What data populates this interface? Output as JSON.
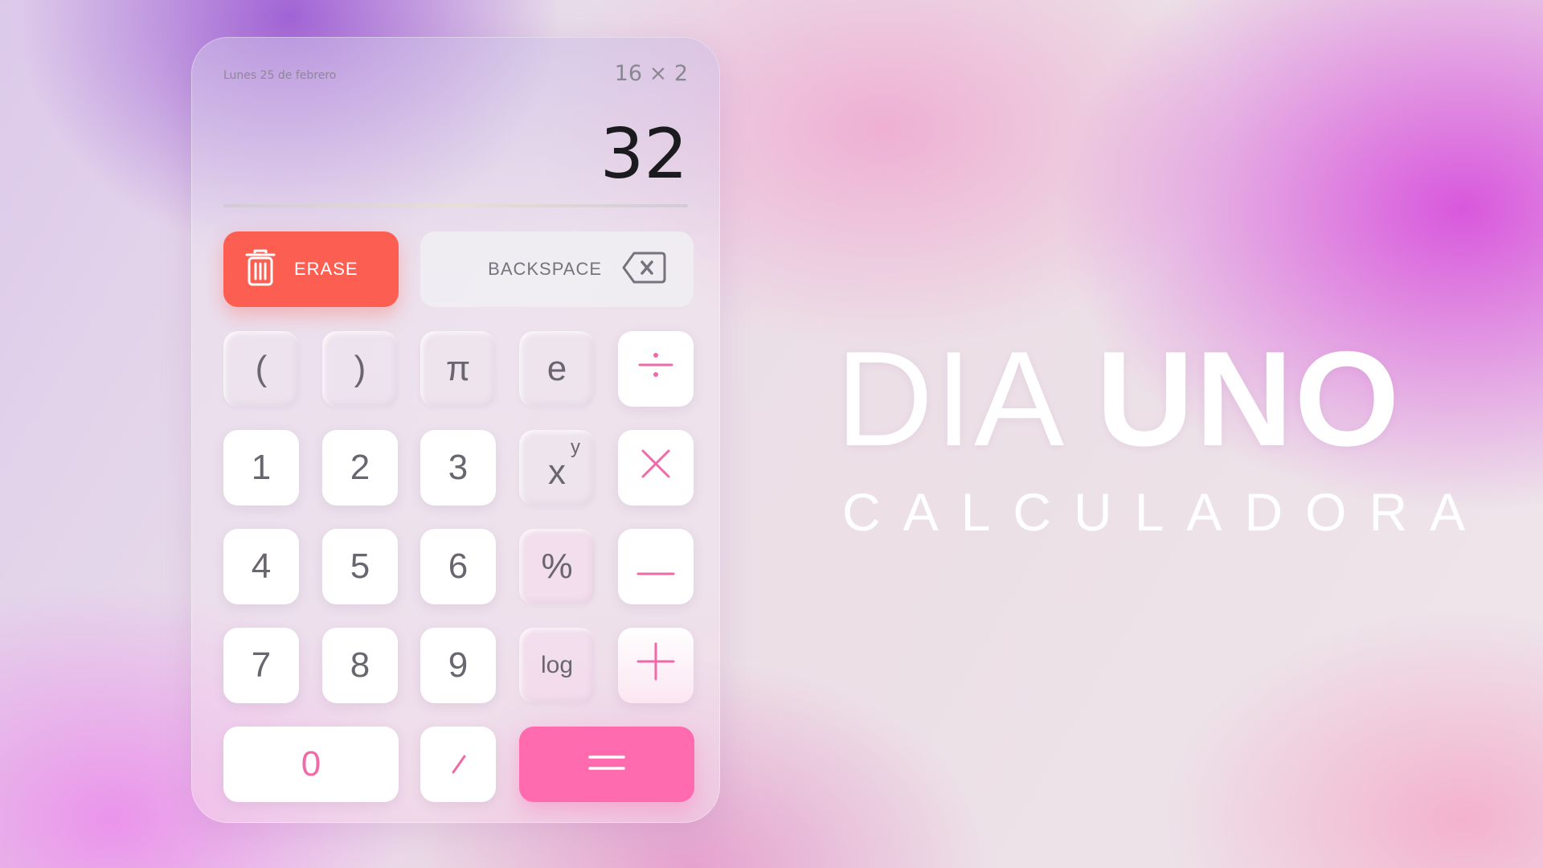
{
  "display": {
    "date": "Lunes 25 de febrero",
    "expression": "16 × 2",
    "result": "32"
  },
  "actions": {
    "erase_label": "ERASE",
    "backspace_label": "BACKSPACE"
  },
  "keys": {
    "open_paren": "(",
    "close_paren": ")",
    "pi": "π",
    "e": "e",
    "one": "1",
    "two": "2",
    "three": "3",
    "four": "4",
    "five": "5",
    "six": "6",
    "seven": "7",
    "eight": "8",
    "nine": "9",
    "zero": "0",
    "percent": "%",
    "log": "log",
    "power_base": "x",
    "power_exp": "y"
  },
  "headline": {
    "word1": "DIA",
    "word2": "UNO",
    "subtitle": "CALCULADORA"
  },
  "colors": {
    "erase": "#fd5e52",
    "equals": "#ff6bae",
    "operator": "#f06aa8"
  },
  "icons": {
    "erase": "trash-icon",
    "backspace": "backspace-icon",
    "divide": "divide-icon",
    "multiply": "multiply-icon",
    "minus": "minus-icon",
    "plus": "plus-icon",
    "decimal": "decimal-slash-icon",
    "equals": "equals-icon"
  }
}
